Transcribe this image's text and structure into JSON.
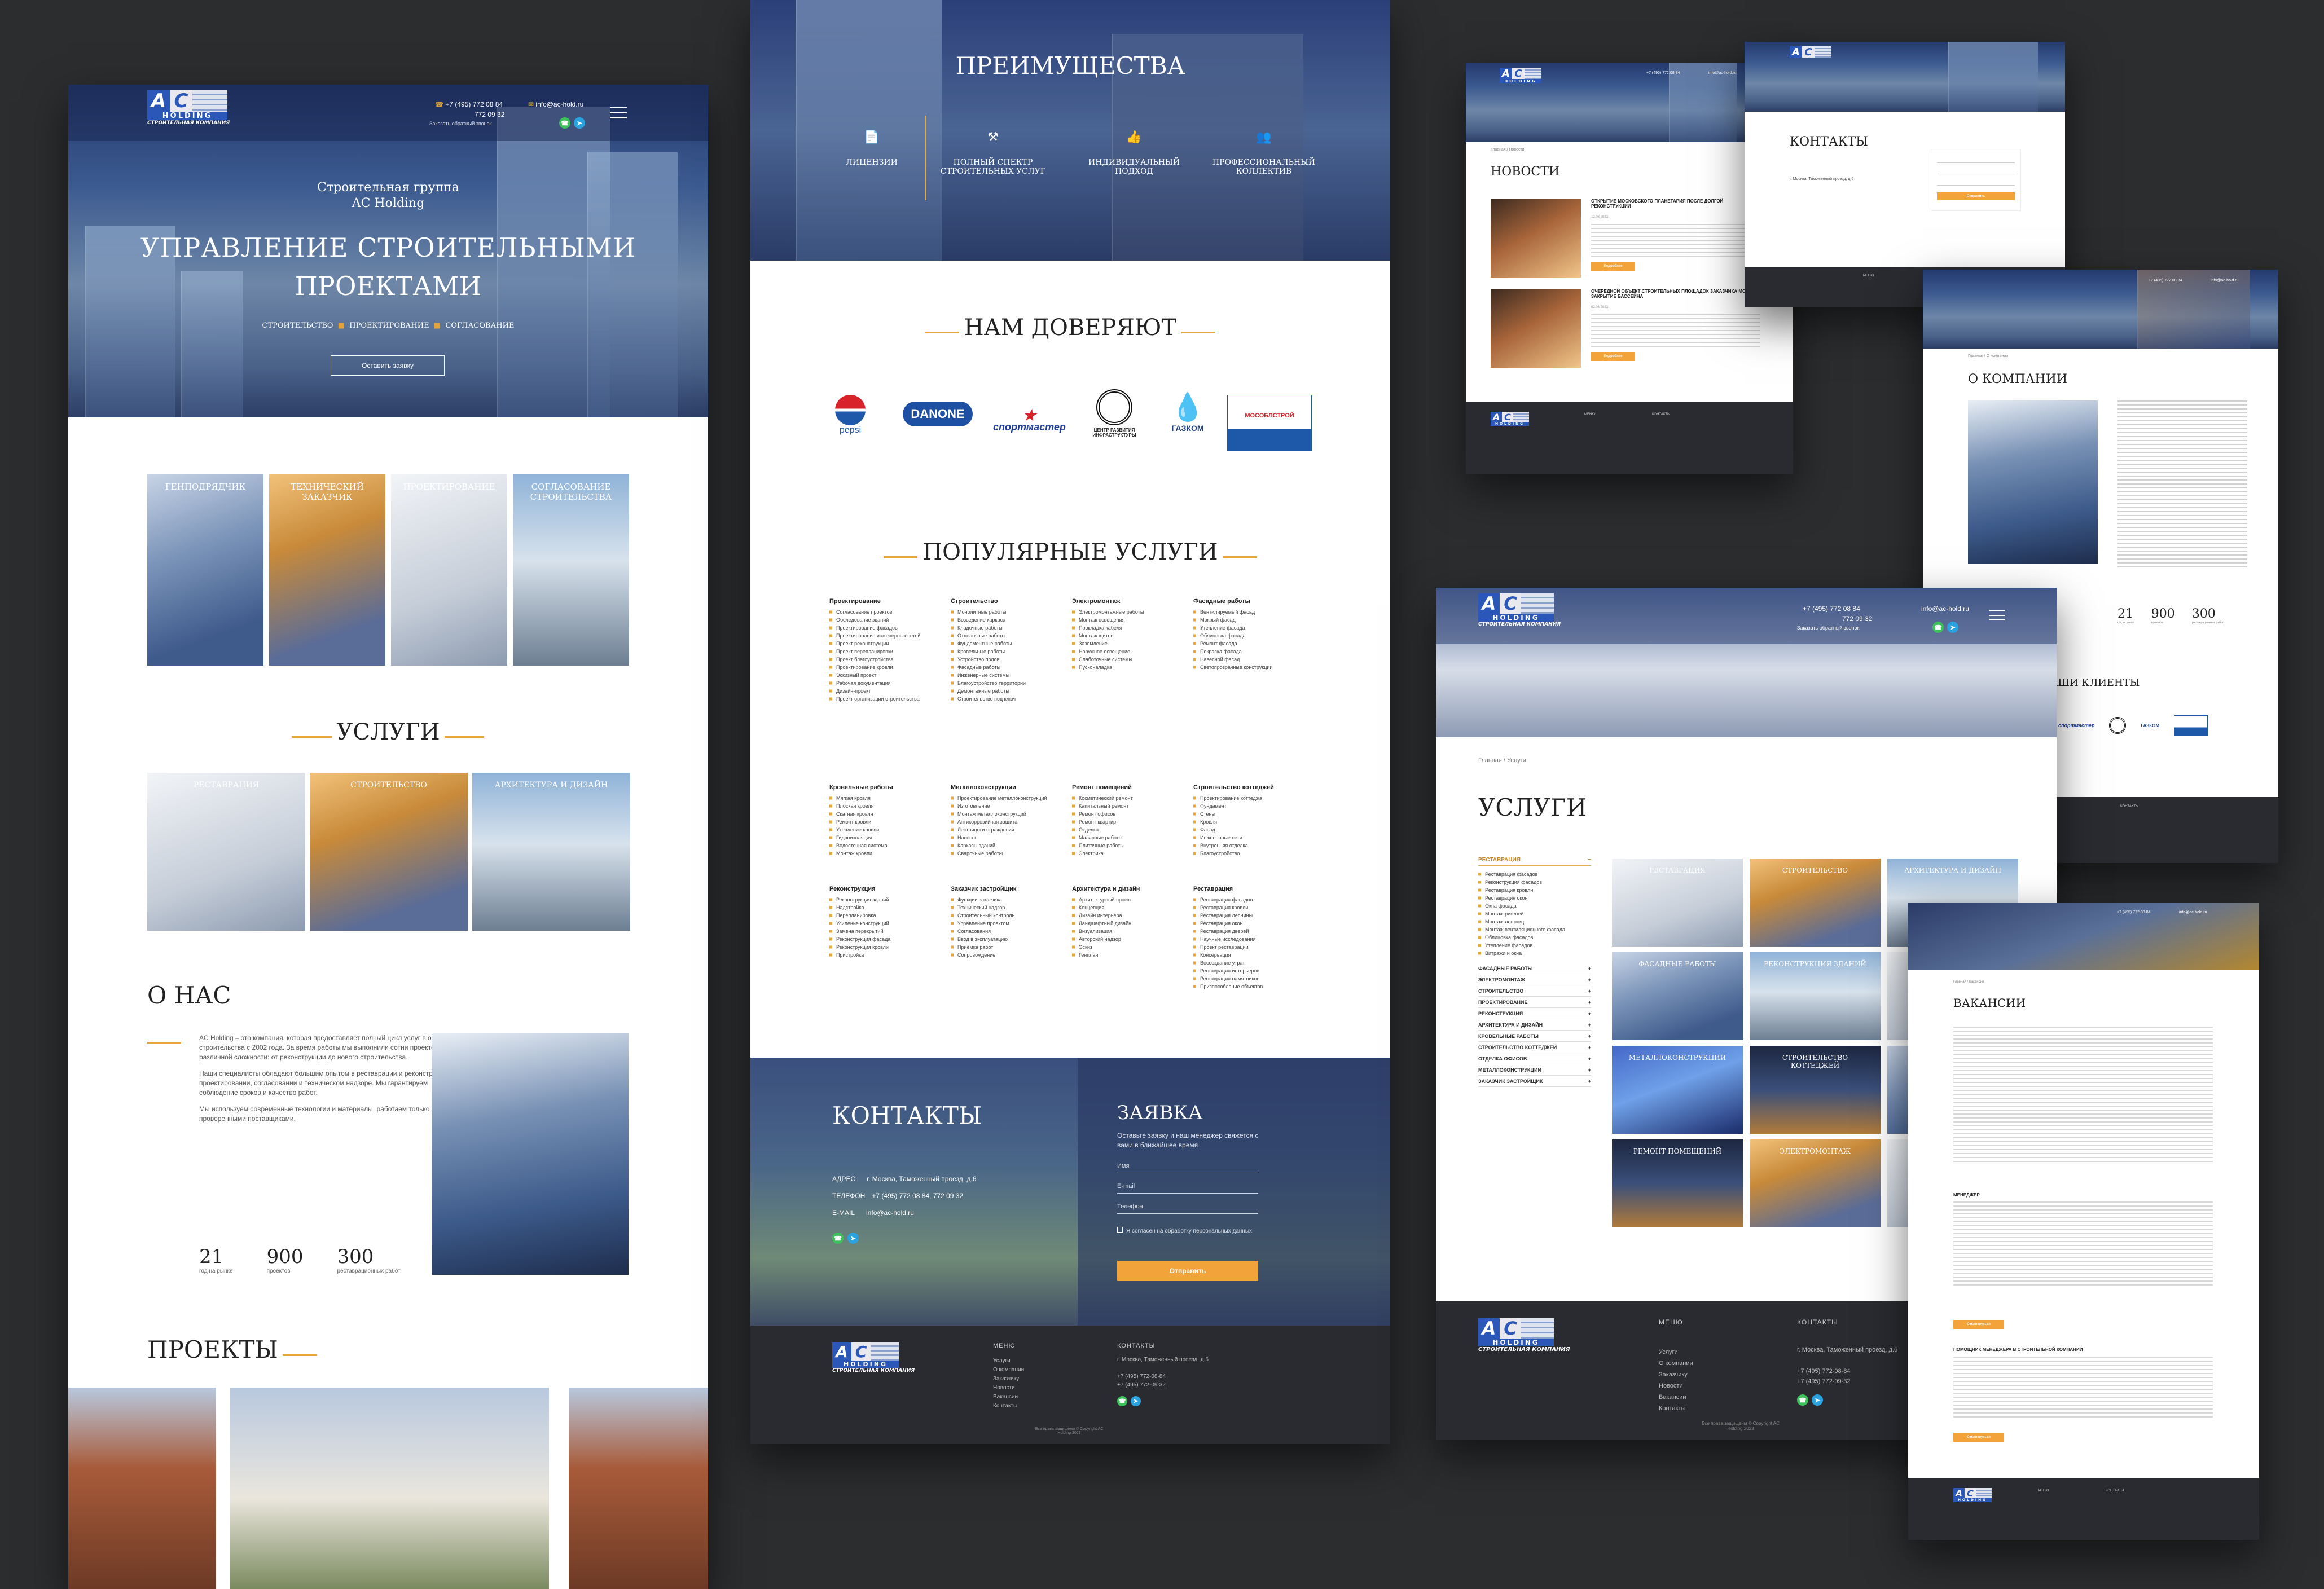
{
  "brand": {
    "logo_letters_a": "A",
    "logo_letters_c": "C",
    "logo_holding": "HOLDING",
    "logo_tagline": "СТРОИТЕЛЬНАЯ КОМПАНИЯ",
    "phone1": "+7 (495) 772 08 84",
    "phone2": "772 09 32",
    "email": "info@ac-hold.ru",
    "callback": "Заказать обратный звонок"
  },
  "home": {
    "hero_pre": "Строительная группа",
    "hero_pre2": "AC Holding",
    "hero_title1": "УПРАВЛЕНИЕ СТРОИТЕЛЬНЫМИ",
    "hero_title2": "ПРОЕКТАМИ",
    "hero_tags": [
      "СТРОИТЕЛЬСТВО",
      "ПРОЕКТИРОВАНИЕ",
      "СОГЛАСОВАНИЕ"
    ],
    "hero_button": "Оставить заявку",
    "tiles": [
      "ГЕНПОДРЯДЧИК",
      "ТЕХНИЧЕСКИЙ ЗАКАЗЧИК",
      "ПРОЕКТИРОВАНИЕ",
      "СОГЛАСОВАНИЕ СТРОИТЕЛЬСТВА"
    ],
    "services_title": "УСЛУГИ",
    "services": [
      "РЕСТАВРАЦИЯ",
      "СТРОИТЕЛЬСТВО",
      "АРХИТЕКТУРА И ДИЗАЙН"
    ],
    "about_title": "О НАС",
    "about_p1": "AC Holding – это компания, которая предоставляет полный цикл услуг в области строительства с 2002 года. За время работы мы выполнили сотни проектов различной сложности: от реконструкции до нового строительства.",
    "about_p2": "Наши специалисты обладают большим опытом в реставрации и реконструкции, проектировании, согласовании и техническом надзоре. Мы гарантируем соблюдение сроков и качество работ.",
    "about_p3": "Мы используем современные технологии и материалы, работаем только с проверенными поставщиками.",
    "stats": [
      {
        "num": "21",
        "label": "год на рынке"
      },
      {
        "num": "900",
        "label": "проектов"
      },
      {
        "num": "300",
        "label": "реставрационных работ"
      }
    ],
    "projects_title": "ПРОЕКТЫ"
  },
  "middle": {
    "adv_title": "ПРЕИМУЩЕСТВА",
    "adv": [
      "ЛИЦЕНЗИИ",
      "ПОЛНЫЙ СПЕКТР СТРОИТЕЛЬНЫХ УСЛУГ",
      "ИНДИВИДУАЛЬНЫЙ ПОДХОД",
      "ПРОФЕССИОНАЛЬНЫЙ КОЛЛЕКТИВ"
    ],
    "trust_title": "НАМ ДОВЕРЯЮТ",
    "clients": [
      "pepsi",
      "DANONE",
      "спортмастер",
      "ЦЕНТР РАЗВИТИЯ ИНФРАСТРУКТУРЫ",
      "ГАЗКОМ",
      "МОСОБЛСТРОЙ"
    ],
    "popular_title": "ПОПУЛЯРНЫЕ УСЛУГИ",
    "groups": [
      {
        "title": "Проектирование",
        "items": [
          "Согласование проектов",
          "Обследование зданий",
          "Проектирование фасадов",
          "Проектирование инженерных сетей",
          "Проект реконструкции",
          "Проект перепланировки",
          "Проект благоустройства",
          "Проектирование кровли",
          "Эскизный проект",
          "Рабочая документация",
          "Дизайн-проект",
          "Проект организации строительства"
        ]
      },
      {
        "title": "Строительство",
        "items": [
          "Монолитные работы",
          "Возведение каркаса",
          "Кладочные работы",
          "Отделочные работы",
          "Фундаментные работы",
          "Кровельные работы",
          "Устройство полов",
          "Фасадные работы",
          "Инженерные системы",
          "Благоустройство территории",
          "Демонтажные работы",
          "Строительство под ключ"
        ]
      },
      {
        "title": "Электромонтаж",
        "items": [
          "Электромонтажные работы",
          "Монтаж освещения",
          "Прокладка кабеля",
          "Монтаж щитов",
          "Заземление",
          "Наружное освещение",
          "Слаботочные системы",
          "Пусконаладка"
        ]
      },
      {
        "title": "Фасадные работы",
        "items": [
          "Вентилируемый фасад",
          "Мокрый фасад",
          "Утепление фасада",
          "Облицовка фасада",
          "Ремонт фасада",
          "Покраска фасада",
          "Навесной фасад",
          "Светопрозрачные конструкции"
        ]
      },
      {
        "title": "Кровельные работы",
        "items": [
          "Мягкая кровля",
          "Плоская кровля",
          "Скатная кровля",
          "Ремонт кровли",
          "Утепление кровли",
          "Гидроизоляция",
          "Водосточная система",
          "Монтаж кровли"
        ]
      },
      {
        "title": "Металлоконструкции",
        "items": [
          "Проектирование металлоконструкций",
          "Изготовление",
          "Монтаж металлоконструкций",
          "Антикоррозийная защита",
          "Лестницы и ограждения",
          "Навесы",
          "Каркасы зданий",
          "Сварочные работы"
        ]
      },
      {
        "title": "Ремонт помещений",
        "items": [
          "Косметический ремонт",
          "Капитальный ремонт",
          "Ремонт офисов",
          "Ремонт квартир",
          "Отделка",
          "Малярные работы",
          "Плиточные работы",
          "Электрика"
        ]
      },
      {
        "title": "Строительство коттеджей",
        "items": [
          "Проектирование коттеджа",
          "Фундамент",
          "Стены",
          "Кровля",
          "Фасад",
          "Инженерные сети",
          "Внутренняя отделка",
          "Благоустройство"
        ]
      },
      {
        "title": "Реконструкция",
        "items": [
          "Реконструкция зданий",
          "Надстройка",
          "Перепланировка",
          "Усиление конструкций",
          "Замена перекрытий",
          "Реконструкция фасада",
          "Реконструкция кровли",
          "Пристройка"
        ]
      },
      {
        "title": "Заказчик застройщик",
        "items": [
          "Функции заказчика",
          "Технический надзор",
          "Строительный контроль",
          "Управление проектом",
          "Согласования",
          "Ввод в эксплуатацию",
          "Приёмка работ",
          "Сопровождение"
        ]
      },
      {
        "title": "Архитектура и дизайн",
        "items": [
          "Архитектурный проект",
          "Концепция",
          "Дизайн интерьера",
          "Ландшафтный дизайн",
          "Визуализация",
          "Авторский надзор",
          "Эскиз",
          "Генплан"
        ]
      },
      {
        "title": "Реставрация",
        "items": [
          "Реставрация фасадов",
          "Реставрация кровли",
          "Реставрация лепнины",
          "Реставрация окон",
          "Реставрация дверей",
          "Научные исследования",
          "Проект реставрации",
          "Консервация",
          "Воссоздание утрат",
          "Реставрация интерьеров",
          "Реставрация памятников",
          "Приспособление объектов"
        ]
      }
    ],
    "contacts_title": "КОНТАКТЫ",
    "addr_label": "АДРЕС",
    "addr": "г. Москва, Таможенный проезд, д.6",
    "tel_label": "ТЕЛЕФОН",
    "tel": "+7 (495) 772 08 84, 772 09 32",
    "mail_label": "E-MAIL",
    "mail": "info@ac-hold.ru",
    "form_title": "ЗАЯВКА",
    "form_sub": "Оставьте заявку и наш менеджер свяжется с вами в ближайшее время",
    "f_name": "Имя",
    "f_mail": "E-mail",
    "f_phone": "Телефон",
    "consent": "Я согласен на обработку персональных данных",
    "send": "Отправить"
  },
  "footer": {
    "menu_title": "МЕНЮ",
    "contacts_title": "КОНТАКТЫ",
    "menu": [
      "Услуги",
      "О компании",
      "Заказчику",
      "Новости",
      "Вакансии",
      "Контакты"
    ],
    "addr": "г. Москва, Таможенный проезд, д.6",
    "p1": "+7 (495) 772-08-84",
    "p2": "+7 (495) 772-09-32",
    "copy": "Все права защищены © Copyright AC Holding 2023"
  },
  "news": {
    "crumb": "Главная / Новости",
    "title": "НОВОСТИ",
    "items": [
      {
        "title": "ОТКРЫТИЕ МОСКОВСКОГО ПЛАНЕТАРИЯ ПОСЛЕ ДОЛГОЙ РЕКОНСТРУКЦИИ",
        "date": "12.06.2023",
        "more": "Подробнее"
      },
      {
        "title": "ОЧЕРЕДНОЙ ОБЪЕКТ СТРОИТЕЛЬНЫХ ПЛОЩАДОК ЗАКАЗЧИКА МОСКВЫ ЗАКРЫТИЕ БАССЕЙНА",
        "date": "02.06.2023",
        "more": "Подробнее"
      }
    ]
  },
  "contacts_page": {
    "title": "КОНТАКТЫ",
    "addr": "г. Москва, Таможенный проезд, д.6",
    "send": "Отправить"
  },
  "about_page": {
    "crumb": "Главная / О компании",
    "title": "О КОМПАНИИ",
    "clients_title": "НАШИ КЛИЕНТЫ"
  },
  "services_page": {
    "crumb": "Главная / Услуги",
    "title": "УСЛУГИ",
    "active_group": "РЕСТАВРАЦИЯ",
    "sub_items": [
      "Реставрация фасадов",
      "Реконструкция фасадов",
      "Реставрация кровли",
      "Реставрация окон",
      "Окна фасада",
      "Монтаж ригелей",
      "Монтаж лестниц",
      "Монтаж вентиляционного фасада",
      "Облицовка фасадов",
      "Утепление фасадов",
      "Витражи и окна"
    ],
    "groups": [
      "ФАСАДНЫЕ РАБОТЫ",
      "ЭЛЕКТРОМОНТАЖ",
      "СТРОИТЕЛЬСТВО",
      "ПРОЕКТИРОВАНИЕ",
      "РЕКОНСТРУКЦИЯ",
      "АРХИТЕКТУРА И ДИЗАЙН",
      "КРОВЕЛЬНЫЕ РАБОТЫ",
      "СТРОИТЕЛЬСТВО КОТТЕДЖЕЙ",
      "ОТДЕЛКА ОФИСОВ",
      "МЕТАЛЛОКОНСТРУКЦИИ",
      "ЗАКАЗЧИК ЗАСТРОЙЩИК"
    ],
    "tiles": [
      "РЕСТАВРАЦИЯ",
      "СТРОИТЕЛЬСТВО",
      "АРХИТЕКТУРА И ДИЗАЙН",
      "ФАСАДНЫЕ РАБОТЫ",
      "РЕКОНСТРУКЦИЯ ЗДАНИЙ",
      "",
      "МЕТАЛЛОКОНСТРУКЦИИ",
      "СТРОИТЕЛЬСТВО КОТТЕДЖЕЙ",
      "",
      "РЕМОНТ ПОМЕЩЕНИЙ",
      "ЭЛЕКТРОМОНТАЖ",
      ""
    ]
  },
  "vacancy_page": {
    "crumb": "Главная / Вакансии",
    "title": "ВАКАНСИИ",
    "v1": "МЕНЕДЖЕР",
    "v2": "ПОМОЩНИК МЕНЕДЖЕРА В СТРОИТЕЛЬНОЙ КОМПАНИИ",
    "btn": "Откликнуться"
  },
  "colors": {
    "accent": "#e8a73c",
    "brand_blue": "#2a57b8",
    "footer_dark": "#2a2b30",
    "bg": "#2c2d2f"
  }
}
